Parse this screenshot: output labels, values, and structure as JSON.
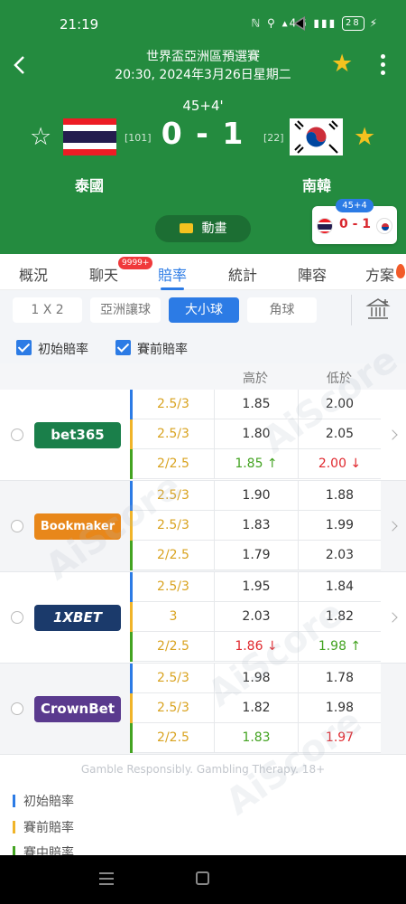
{
  "status_bar": {
    "time": "21:19",
    "indicators": "ℕ ⚲ ▴4G ▮▮▮",
    "battery": "28"
  },
  "match": {
    "competition": "世界盃亞洲區預選賽",
    "datetime": "20:30, 2024年3月26日星期二",
    "minute": "45+4'",
    "score": "0 - 1",
    "home": {
      "name": "泰國",
      "rank": "[101]",
      "flag": "thailand-flag"
    },
    "away": {
      "name": "南韓",
      "rank": "[22]",
      "flag": "south-korea-flag"
    },
    "animation_label": "動畫",
    "mini_card": {
      "minute": "45+4",
      "score": "0 - 1"
    }
  },
  "tabs": {
    "items": [
      {
        "label": "概況"
      },
      {
        "label": "聊天",
        "badge": "9999+"
      },
      {
        "label": "賠率",
        "active": true
      },
      {
        "label": "統計"
      },
      {
        "label": "陣容"
      },
      {
        "label": "方案"
      }
    ]
  },
  "filters": {
    "segments": [
      "1 X 2",
      "亞洲讓球",
      "大小球",
      "角球"
    ],
    "active": "大小球",
    "checkboxes": [
      {
        "label": "初始賠率",
        "checked": true
      },
      {
        "label": "賽前賠率",
        "checked": true
      }
    ]
  },
  "table": {
    "headers": {
      "over": "高於",
      "under": "低於"
    },
    "bookmakers": [
      {
        "name": "bet365",
        "color": "#1a7f4a",
        "rows": [
          {
            "line": "2.5/3",
            "over": "1.85",
            "under": "2.00"
          },
          {
            "line": "2.5/3",
            "over": "1.80",
            "under": "2.05"
          },
          {
            "line": "2/2.5",
            "over": "1.85 ↑",
            "under": "2.00 ↓"
          }
        ]
      },
      {
        "name": "Bookmaker",
        "color": "#e8871a",
        "rows": [
          {
            "line": "2.5/3",
            "over": "1.90",
            "under": "1.88"
          },
          {
            "line": "2.5/3",
            "over": "1.83",
            "under": "1.99"
          },
          {
            "line": "2/2.5",
            "over": "1.79",
            "under": "2.03"
          }
        ]
      },
      {
        "name": "1XBET",
        "color": "#1b3a6b",
        "rows": [
          {
            "line": "2.5/3",
            "over": "1.95",
            "under": "1.84"
          },
          {
            "line": "3",
            "over": "2.03",
            "under": "1.82"
          },
          {
            "line": "2/2.5",
            "over": "1.86 ↓",
            "under": "1.98 ↑"
          }
        ]
      },
      {
        "name": "CrownBet",
        "color": "#5a3a8e",
        "rows": [
          {
            "line": "2.5/3",
            "over": "1.98",
            "under": "1.78"
          },
          {
            "line": "2.5/3",
            "over": "1.82",
            "under": "1.98"
          },
          {
            "line": "2/2.5",
            "over": "1.83",
            "under": "1.97"
          }
        ]
      }
    ]
  },
  "footer": {
    "disclaimer": "Gamble Responsibly. Gambling Therapy. 18+",
    "legend": [
      {
        "label": "初始賠率",
        "color": "#2c7be5"
      },
      {
        "label": "賽前賠率",
        "color": "#f0b429"
      },
      {
        "label": "賽中賠率",
        "color": "#43a321"
      }
    ]
  },
  "watermark": "AiScore",
  "colors": {
    "header_green": "#248b3f",
    "accent_blue": "#2c7be5",
    "star_gold": "#f4c21f",
    "odds_up": "#43a321",
    "odds_down": "#e0282e"
  }
}
